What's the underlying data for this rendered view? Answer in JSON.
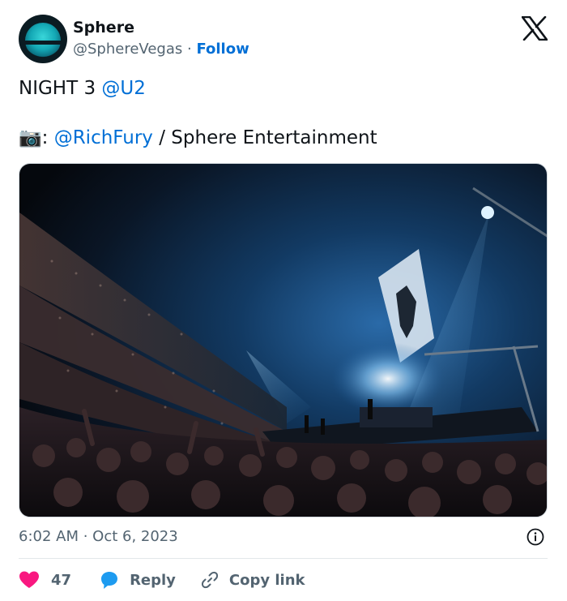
{
  "author": {
    "name": "Sphere",
    "handle": "@SphereVegas",
    "separator": "·",
    "follow_label": "Follow"
  },
  "tweet": {
    "line1_text": "NIGHT 3 ",
    "line1_mention": "@U2",
    "line2_emoji": "📷",
    "line2_colon": ": ",
    "line2_mention": "@RichFury",
    "line2_rest": " / Sphere Entertainment"
  },
  "timestamp": "6:02 AM · Oct 6, 2023",
  "actions": {
    "like_count": "47",
    "reply_label": "Reply",
    "copy_link_label": "Copy link"
  },
  "colors": {
    "link": "#006fd6",
    "like": "#f91880",
    "reply": "#1d9bf0",
    "text_secondary": "#536471"
  },
  "icons": [
    "x-logo-icon",
    "info-icon",
    "heart-icon",
    "reply-bubble-icon",
    "link-icon",
    "camera-emoji-icon"
  ]
}
